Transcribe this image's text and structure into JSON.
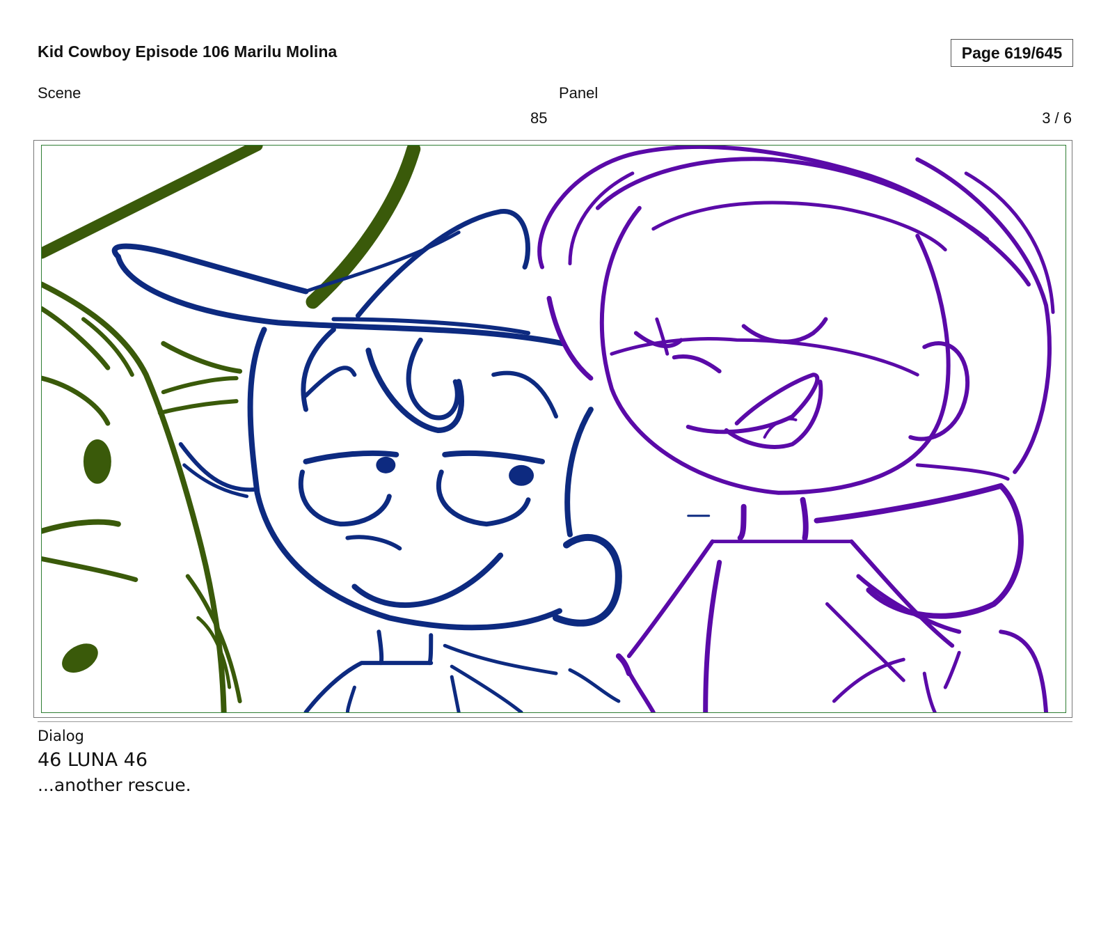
{
  "header": {
    "title": "Kid Cowboy Episode 106 Marilu Molina",
    "page": "Page 619/645"
  },
  "meta": {
    "scene_label": "Scene",
    "panel_label": "Panel",
    "scene_value": "85",
    "panel_value": "3 / 6"
  },
  "panel": {
    "frame_color": "#2e7d32",
    "line_colors": {
      "left_character": "#3a5a0a",
      "boy": "#0d2a80",
      "girl": "#5a0aa8"
    }
  },
  "dialog": {
    "label": "Dialog",
    "speaker": "46 LUNA 46",
    "line": "...another rescue."
  }
}
